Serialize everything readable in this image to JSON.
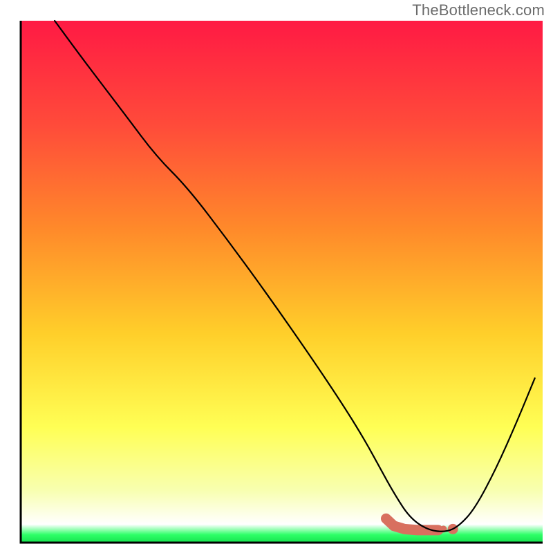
{
  "watermark": "TheBottleneck.com",
  "chart_data": {
    "type": "line",
    "title": "",
    "xlabel": "",
    "ylabel": "",
    "xlim": [
      0,
      100
    ],
    "ylim": [
      0,
      100
    ],
    "grid": false,
    "legend": false,
    "gradient_stops": [
      {
        "offset": 0.0,
        "color": "#ff1a44"
      },
      {
        "offset": 0.2,
        "color": "#ff4b3a"
      },
      {
        "offset": 0.4,
        "color": "#ff8a2a"
      },
      {
        "offset": 0.6,
        "color": "#ffcf2a"
      },
      {
        "offset": 0.78,
        "color": "#ffff55"
      },
      {
        "offset": 0.9,
        "color": "#f8ffb0"
      },
      {
        "offset": 0.965,
        "color": "#ffffff"
      },
      {
        "offset": 0.985,
        "color": "#2dff67"
      },
      {
        "offset": 1.0,
        "color": "#17e24f"
      }
    ],
    "series": [
      {
        "name": "bottleneck-curve",
        "stroke": "#000000",
        "stroke_width": 2.2,
        "x": [
          6.5,
          12.0,
          20.0,
          26.0,
          32.0,
          40.0,
          48.0,
          56.0,
          62.0,
          66.0,
          69.0,
          71.5,
          74.5,
          78.0,
          81.5,
          84.0,
          87.0,
          91.0,
          95.0,
          98.5
        ],
        "y": [
          100.0,
          92.5,
          82.0,
          74.0,
          68.0,
          57.5,
          46.5,
          35.0,
          26.0,
          19.5,
          14.0,
          9.5,
          4.8,
          2.4,
          2.0,
          3.2,
          6.5,
          14.0,
          23.0,
          31.5
        ]
      },
      {
        "name": "valley-marker",
        "type": "shape",
        "fill": "#d8705f",
        "x": [
          70.0,
          71.5,
          73.5,
          76.0,
          78.0,
          80.0,
          81.0,
          82.8
        ],
        "y": [
          4.6,
          3.2,
          2.6,
          2.4,
          2.4,
          2.4,
          2.6,
          2.6
        ]
      }
    ],
    "annotations": []
  }
}
